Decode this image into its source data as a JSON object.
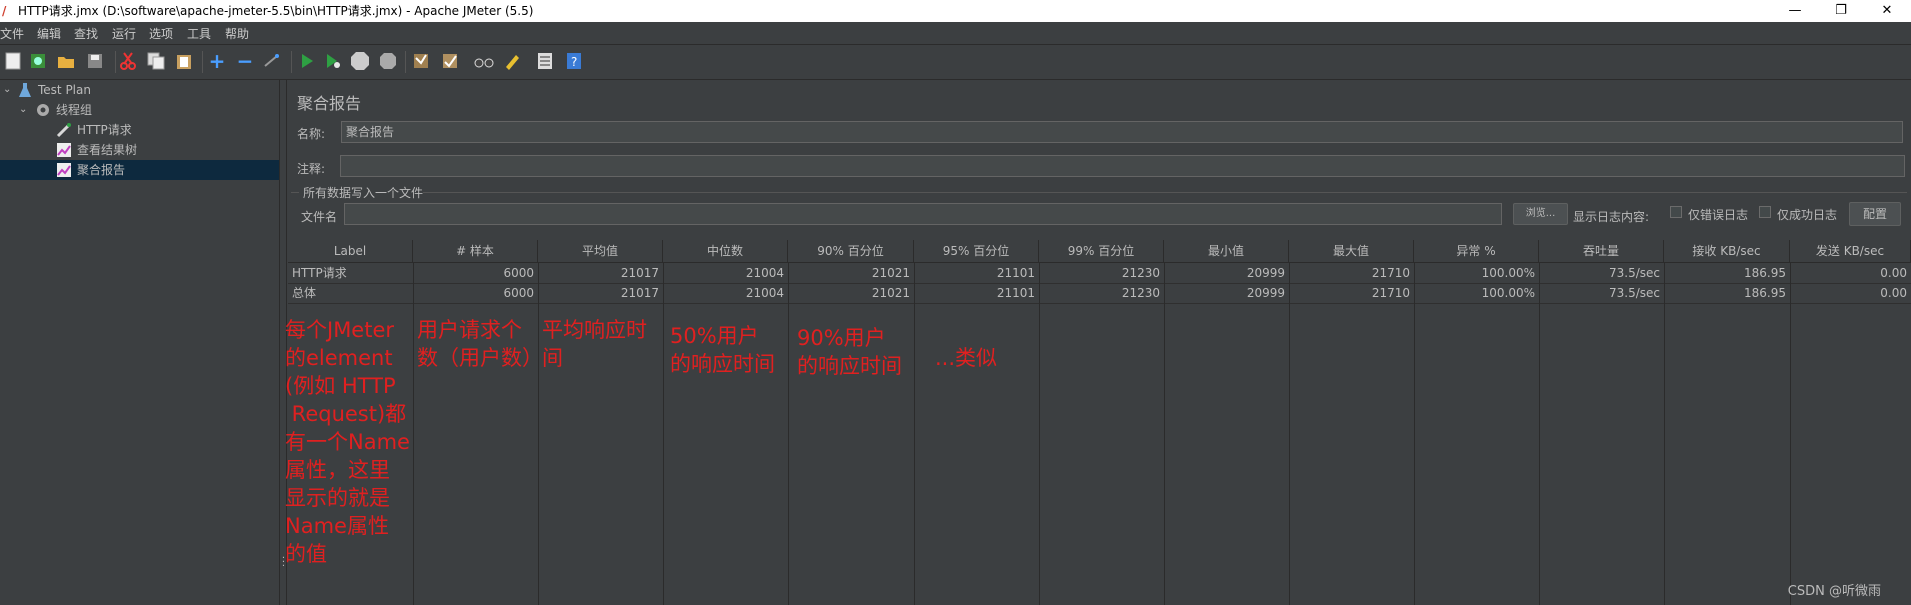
{
  "window": {
    "title": "HTTP请求.jmx (D:\\software\\apache-jmeter-5.5\\bin\\HTTP请求.jmx) - Apache JMeter (5.5)",
    "minimize": "—",
    "restore": "❐",
    "close": "✕"
  },
  "menu": [
    "文件",
    "编辑",
    "查找",
    "运行",
    "选项",
    "工具",
    "帮助"
  ],
  "tree": {
    "items": [
      {
        "label": "Test Plan",
        "icon": "flask-icon"
      },
      {
        "label": "线程组",
        "icon": "gear-icon"
      },
      {
        "label": "HTTP请求",
        "icon": "pipette-icon"
      },
      {
        "label": "查看结果树",
        "icon": "graph-icon"
      },
      {
        "label": "聚合报告",
        "icon": "graph-icon"
      }
    ]
  },
  "panel": {
    "title": "聚合报告",
    "name_label": "名称:",
    "name_value": "聚合报告",
    "comment_label": "注释:",
    "comment_value": "",
    "group_title": "所有数据写入一个文件",
    "filename_label": "文件名",
    "filename_value": "",
    "browse_button": "浏览...",
    "log_label": "显示日志内容:",
    "errors_only_label": "仅错误日志",
    "success_only_label": "仅成功日志",
    "configure_button": "配置"
  },
  "table": {
    "headers": [
      "Label",
      "# 样本",
      "平均值",
      "中位数",
      "90% 百分位",
      "95% 百分位",
      "99% 百分位",
      "最小值",
      "最大值",
      "异常 %",
      "吞吐量",
      "接收 KB/sec",
      "发送 KB/sec"
    ],
    "rows": [
      [
        "HTTP请求",
        "6000",
        "21017",
        "21004",
        "21021",
        "21101",
        "21230",
        "20999",
        "21710",
        "100.00%",
        "73.5/sec",
        "186.95",
        "0.00"
      ],
      [
        "总体",
        "6000",
        "21017",
        "21004",
        "21021",
        "21101",
        "21230",
        "20999",
        "21710",
        "100.00%",
        "73.5/sec",
        "186.95",
        "0.00"
      ]
    ]
  },
  "annotations": {
    "label_col": [
      "每个JMeter",
      "的element",
      "(例如 HTTP",
      " Request)都",
      "有一个Name",
      "属性，这里",
      "显示的就是",
      "Name属性",
      "的值"
    ],
    "samples_col": [
      "用户请求个",
      "数（用户数）"
    ],
    "avg_col": [
      "平均响应时",
      "间"
    ],
    "median_col": [
      "50%用户",
      "的响应时间"
    ],
    "p90_col": [
      "90%用户",
      "的响应时间"
    ],
    "p95_col": [
      "...类似"
    ]
  },
  "watermark": "CSDN @听微雨",
  "colors": {
    "background": "#3c3f41",
    "annotation": "#e02020",
    "selected": "#0d293e"
  }
}
